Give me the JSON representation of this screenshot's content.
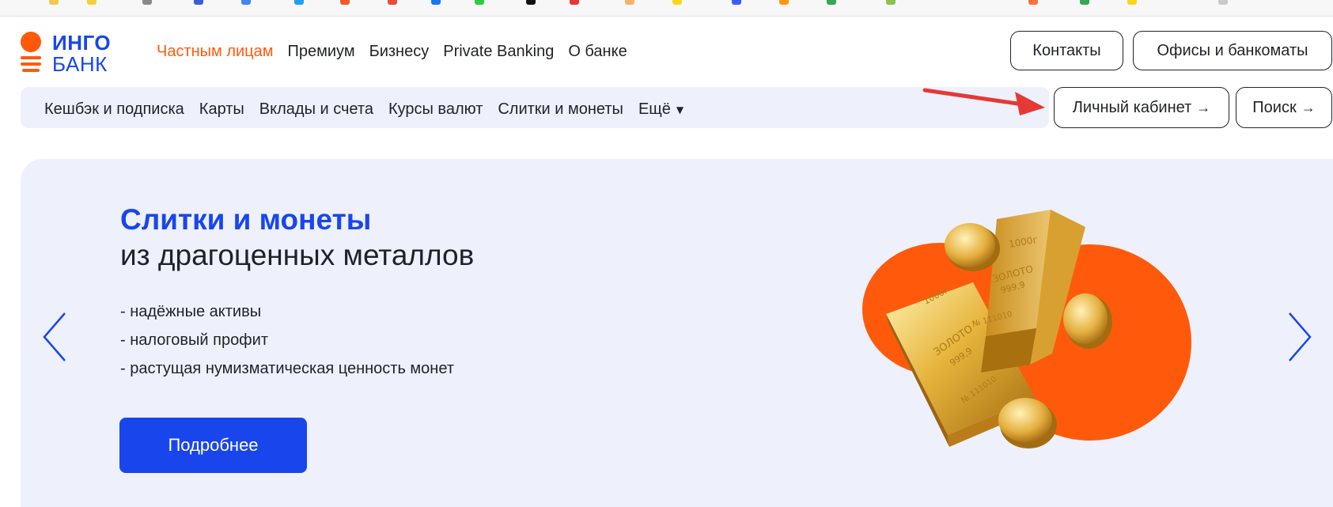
{
  "header": {
    "logo": {
      "line1": "ИНГО",
      "line2": "БАНК"
    },
    "nav": [
      {
        "label": "Частным лицам",
        "active": true
      },
      {
        "label": "Премиум",
        "active": false
      },
      {
        "label": "Бизнесу",
        "active": false
      },
      {
        "label": "Private Banking",
        "active": false
      },
      {
        "label": "О банке",
        "active": false
      }
    ],
    "contacts_label": "Контакты",
    "offices_label": "Офисы и банкоматы"
  },
  "subnav": {
    "items": [
      "Кешбэк и подписка",
      "Карты",
      "Вклады и счета",
      "Курсы валют",
      "Слитки и монеты"
    ],
    "more_label": "Ещё",
    "cabinet_label": "Личный кабинет",
    "search_label": "Поиск"
  },
  "hero": {
    "title": "Слитки и монеты",
    "subtitle": "из драгоценных металлов",
    "bullets": [
      "- надёжные активы",
      "- налоговый профит",
      "- растущая нумизматическая ценность монет"
    ],
    "cta_label": "Подробнее",
    "bar1": {
      "l1": "1000г",
      "l2": "ЗОЛОТО",
      "l3": "999,9",
      "l4": "№ 111010"
    },
    "bar2": {
      "l1": "1000г",
      "l2": "ЗОЛОТО",
      "l3": "999,9",
      "l4": "№ 111010"
    }
  },
  "colors": {
    "accent_blue": "#1946ec",
    "accent_orange": "#ff5a0b",
    "hero_bg": "#eef1fc",
    "annotation_red": "#e53935"
  },
  "icons": [
    "chevron-left-icon",
    "chevron-right-icon",
    "arrow-right-icon",
    "caret-down-icon",
    "red-annotation-arrow"
  ]
}
